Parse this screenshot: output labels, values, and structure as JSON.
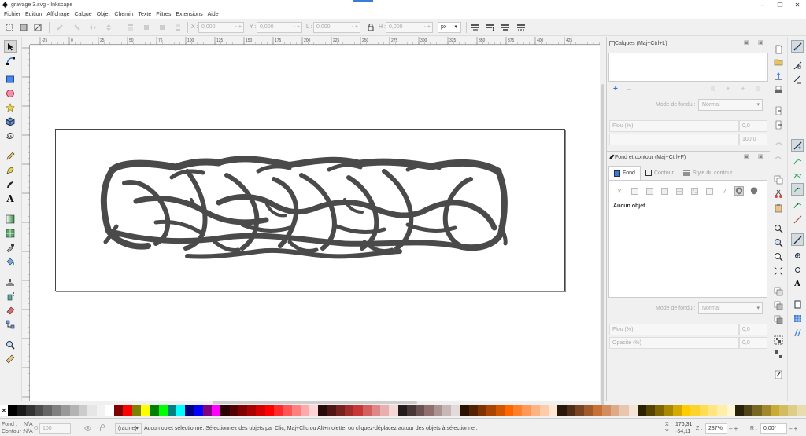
{
  "window": {
    "title": "gravage 3.svg - Inkscape",
    "minimize": "–",
    "maximize": "❐",
    "close": "✕"
  },
  "menu": [
    "Fichier",
    "Edition",
    "Affichage",
    "Calque",
    "Objet",
    "Chemin",
    "Texte",
    "Filtres",
    "Extensions",
    "Aide"
  ],
  "toolbar": {
    "x_label": "X :",
    "x_value": "0,000",
    "y_label": "Y :",
    "y_value": "0,000",
    "w_label": "L :",
    "w_value": "0,000",
    "h_label": "H :",
    "h_value": "0,000",
    "unit": "px",
    "spin": "- +"
  },
  "ruler": {
    "ticks": [
      "-25",
      "0",
      "25",
      "50",
      "75",
      "100",
      "125",
      "150",
      "175",
      "200",
      "225",
      "250",
      "275",
      "300",
      "325",
      "350",
      "375",
      "400",
      "425"
    ]
  },
  "layers": {
    "title": "Calques (Maj+Ctrl+L)",
    "add": "+",
    "remove": "–",
    "blend_label": "Mode de fondu :",
    "blend_value": "Normal",
    "blur_label": "Flou (%)",
    "blur_value": "0,0",
    "opacity_value": "100,0"
  },
  "fill_stroke": {
    "title": "Fond et contour (Maj+Ctrl+F)",
    "tab_fill": "Fond",
    "tab_stroke": "Contour",
    "tab_style": "Style du contour",
    "no_object": "Aucun objet",
    "unset": "?",
    "blend_label": "Mode de fondu :",
    "blend_value": "Normal",
    "blur_label": "Flou (%)",
    "blur_value": "0,0",
    "opacity_label": "Opacité (%)",
    "opacity_value": "0,0"
  },
  "status": {
    "fill_label": "Fond :",
    "fill_value": "N/A",
    "stroke_label": "Contour :",
    "stroke_value": "N/A",
    "o_label": "O:",
    "o_value": "100",
    "layer": "(racine)",
    "message": "Aucun objet sélectionné. Sélectionnez des objets par Clic, Maj+Clic ou Alt+molette, ou cliquez-déplacez autour des objets à sélectionner.",
    "x_label": "X :",
    "x_value": "176,31",
    "y_label": "Y :",
    "y_value": "-64,11",
    "zoom_label": "Z :",
    "zoom_value": "287%",
    "rotate_label": "R :",
    "rotate_value": "0,00°",
    "spin": "– +"
  },
  "colors": {
    "accent": "#3a7bd5",
    "drawing": "#4a4a4a"
  }
}
